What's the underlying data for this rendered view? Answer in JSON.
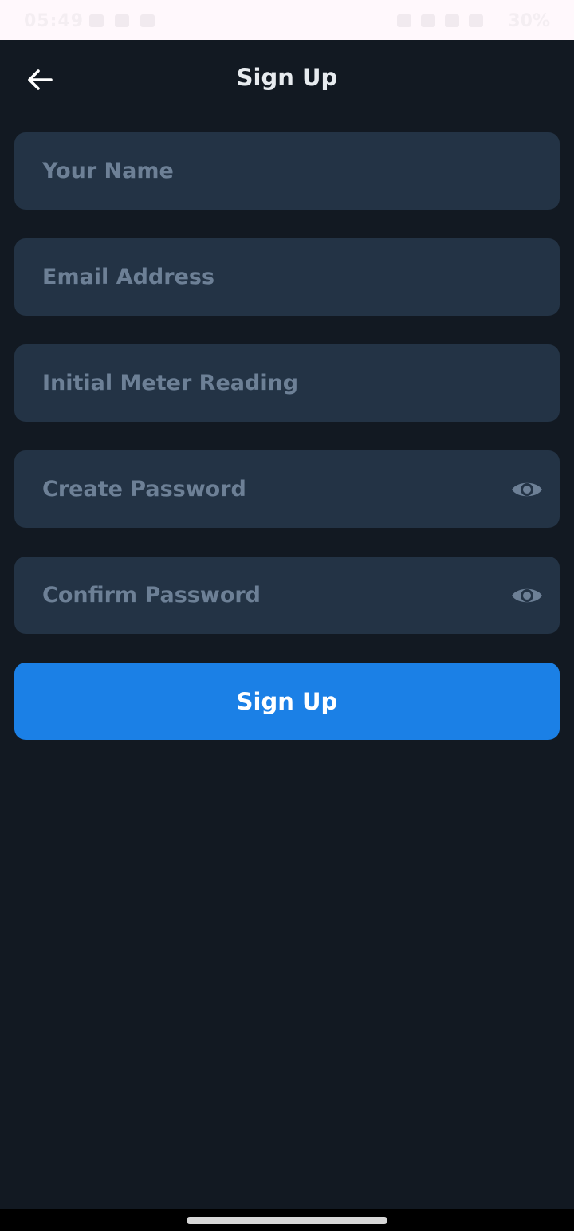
{
  "status_bar": {
    "time": "05:49",
    "battery": "30%"
  },
  "header": {
    "title": "Sign Up",
    "back_icon": "arrow-left-icon"
  },
  "form": {
    "name_placeholder": "Your Name",
    "email_placeholder": "Email Address",
    "meter_placeholder": "Initial Meter Reading",
    "password_placeholder": "Create Password",
    "confirm_placeholder": "Confirm Password",
    "eye_icon": "eye-icon",
    "submit_label": "Sign Up"
  },
  "colors": {
    "background": "#121922",
    "field": "#233345",
    "placeholder": "#6d8096",
    "accent": "#1b80e6"
  }
}
